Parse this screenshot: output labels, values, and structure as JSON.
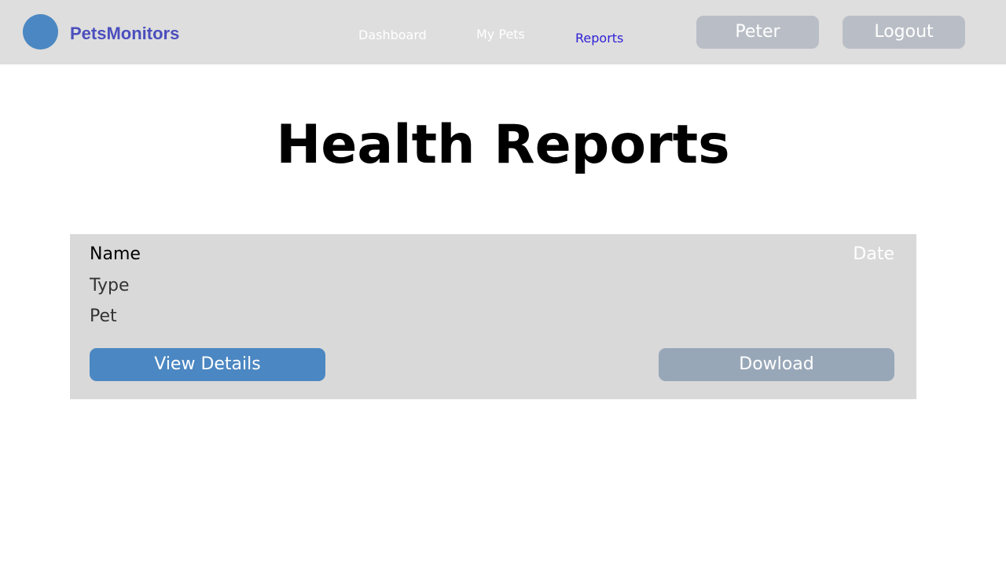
{
  "app": {
    "brand": "PetsMonitors"
  },
  "nav": {
    "dashboard": "Dashboard",
    "my_pets": "My Pets",
    "reports": "Reports",
    "user": "Peter",
    "logout": "Logout"
  },
  "main": {
    "title": "Health Reports"
  },
  "report": {
    "name_label": "Name",
    "type_label": "Type",
    "pet_label": "Pet",
    "date_label": "Date",
    "view_details": "View Details",
    "download": "Dowload"
  },
  "colors": {
    "brand": "#4b4fbd",
    "active_nav": "#2e1fd6",
    "primary_button": "#4b87c2",
    "secondary_button": "#98a7b8",
    "navbar_bg": "#dedede",
    "card_bg": "#d9d9d9"
  },
  "icons": {
    "logo": "logo-circle-icon"
  }
}
